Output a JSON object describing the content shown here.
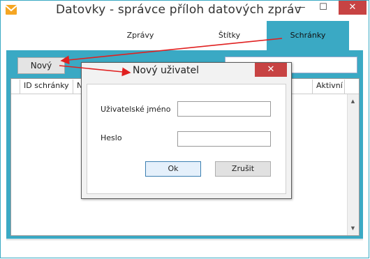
{
  "window": {
    "title": "Datovky - správce příloh datových zpráv",
    "minimize_glyph": "—",
    "maximize_glyph": "☐",
    "close_glyph": "✕"
  },
  "tabs": [
    {
      "label": "Zprávy",
      "selected": false
    },
    {
      "label": "Štítky",
      "selected": false
    },
    {
      "label": "Schránky",
      "selected": true
    }
  ],
  "toolbar": {
    "new_label": "Nový",
    "search_value": ""
  },
  "grid": {
    "columns": [
      "ID schránky",
      "N",
      "Aktivní"
    ],
    "rows": [],
    "scroll_up_glyph": "▲",
    "scroll_down_glyph": "▼"
  },
  "dialog": {
    "title": "Nový uživatel",
    "close_glyph": "✕",
    "username_label": "Uživatelské jméno",
    "password_label": "Heslo",
    "username_value": "",
    "password_value": "",
    "ok_label": "Ok",
    "cancel_label": "Zrušit"
  },
  "colors": {
    "accent": "#3aa9c4",
    "close": "#c74343",
    "annotation": "#e02020"
  },
  "icons": {
    "app": "envelope-icon"
  }
}
